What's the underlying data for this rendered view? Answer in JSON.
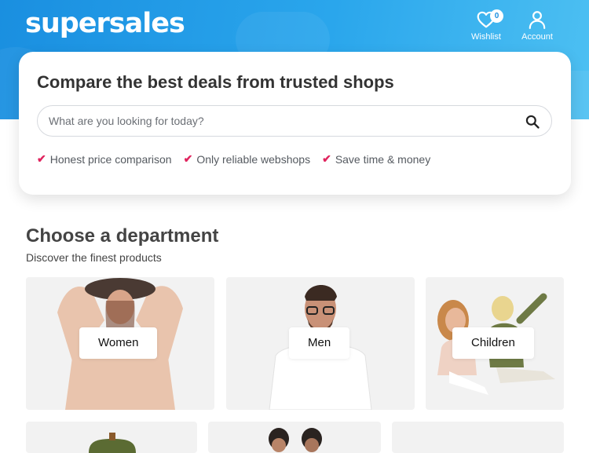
{
  "brand": {
    "logo_text": "supersales",
    "accent_color": "#e0245e",
    "header_gradient": [
      "#1a8fe0",
      "#4dc0f2"
    ]
  },
  "header": {
    "wishlist": {
      "label": "Wishlist",
      "count": "0",
      "icon": "heart-icon"
    },
    "account": {
      "label": "Account",
      "icon": "user-icon"
    }
  },
  "search": {
    "title": "Compare the best deals from trusted shops",
    "placeholder": "What are you looking for today?",
    "icon": "search-icon",
    "usps": [
      "Honest price comparison",
      "Only reliable webshops",
      "Save time & money"
    ]
  },
  "departments": {
    "title": "Choose a department",
    "subtitle": "Discover the finest products",
    "items": [
      {
        "label": "Women"
      },
      {
        "label": "Men"
      },
      {
        "label": "Children"
      }
    ]
  }
}
